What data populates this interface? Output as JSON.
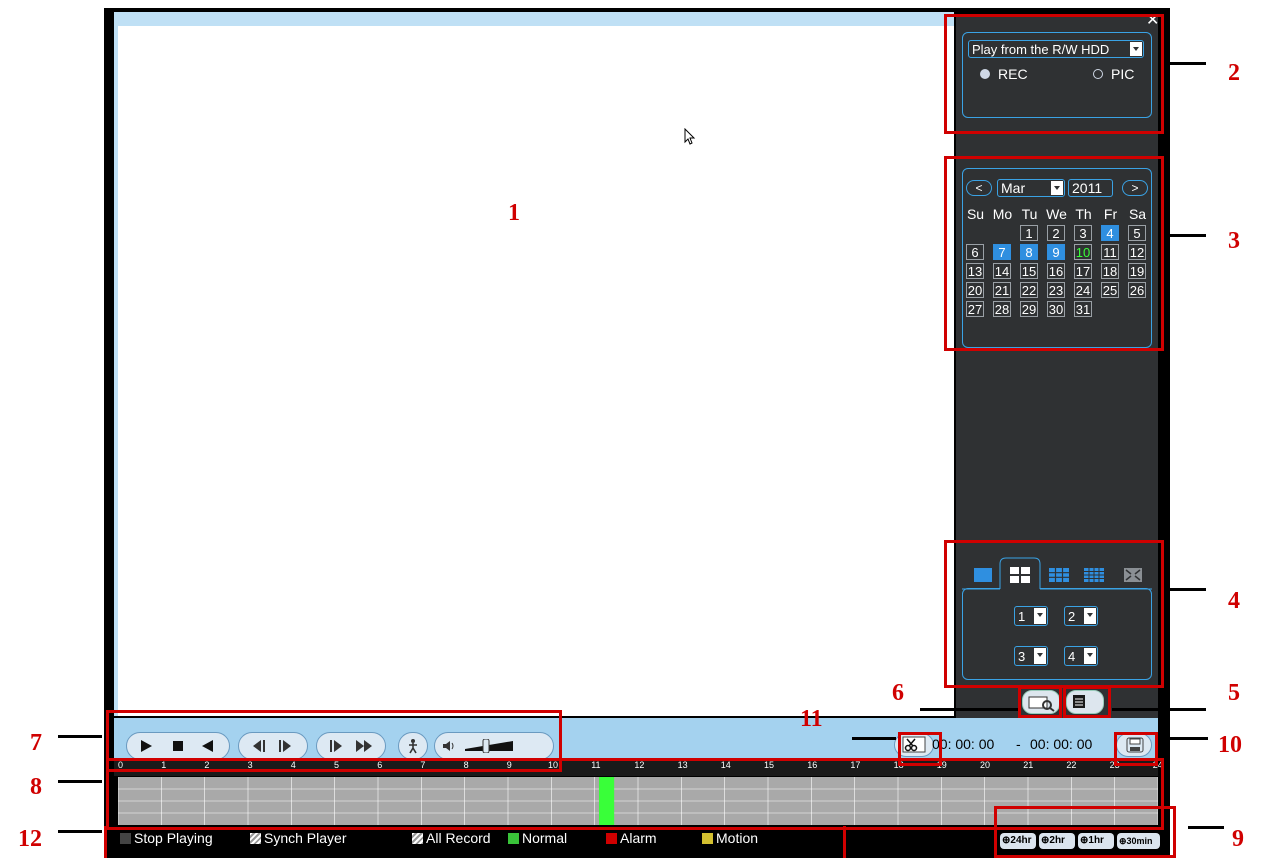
{
  "source_select": {
    "value": "Play from the R/W HDD"
  },
  "type_radios": [
    {
      "label": "REC",
      "checked": true
    },
    {
      "label": "PIC",
      "checked": false
    }
  ],
  "calendar": {
    "prev": "<",
    "next": ">",
    "month": "Mar",
    "year": "2011",
    "weekdays": [
      "Su",
      "Mo",
      "Tu",
      "We",
      "Th",
      "Fr",
      "Sa"
    ],
    "days": [
      "1",
      "2",
      "3",
      "4",
      "5",
      "6",
      "7",
      "8",
      "9",
      "10",
      "11",
      "12",
      "13",
      "14",
      "15",
      "16",
      "17",
      "18",
      "19",
      "20",
      "21",
      "22",
      "23",
      "24",
      "25",
      "26",
      "27",
      "28",
      "29",
      "30",
      "31"
    ],
    "first_weekday": 2,
    "recorded_days": [
      4,
      7,
      8,
      9
    ],
    "today": 10
  },
  "channel_selects": [
    "1",
    "2",
    "3",
    "4"
  ],
  "time": {
    "start": "00: 00: 00",
    "separator": "-",
    "end": "00: 00: 00"
  },
  "timeline": {
    "ticks": [
      "0",
      "1",
      "2",
      "3",
      "4",
      "5",
      "6",
      "7",
      "8",
      "9",
      "10",
      "11",
      "12",
      "13",
      "14",
      "15",
      "16",
      "17",
      "18",
      "19",
      "20",
      "21",
      "22",
      "23",
      "24"
    ]
  },
  "legend": {
    "stop": "Stop Playing",
    "synch": "Synch Player",
    "all": "All Record",
    "normal": "Normal",
    "alarm": "Alarm",
    "motion": "Motion"
  },
  "zoom_buttons": [
    "24hr",
    "2hr",
    "1hr",
    "30min"
  ],
  "callouts": [
    "1",
    "2",
    "3",
    "4",
    "5",
    "6",
    "7",
    "8",
    "9",
    "10",
    "11",
    "12"
  ],
  "colors": {
    "accent": "#3aa2e4",
    "record": "#39ff39",
    "annotation": "#d00000",
    "panel": "#2f3133"
  }
}
